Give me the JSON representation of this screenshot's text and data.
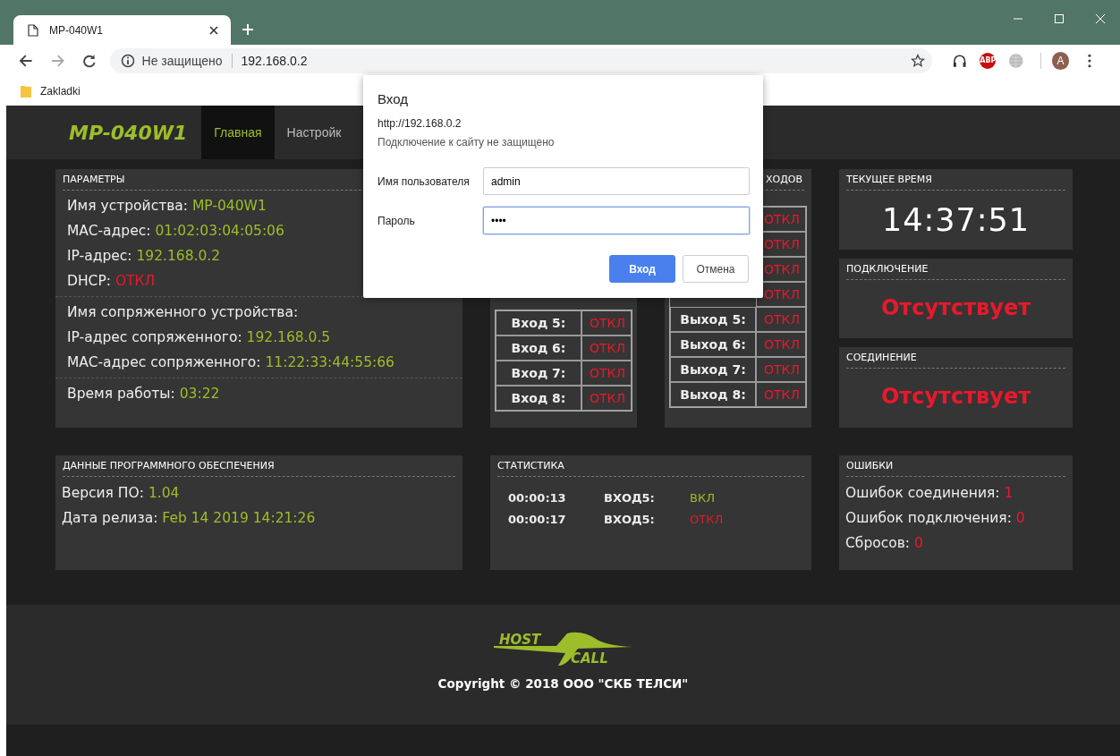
{
  "browser": {
    "tab_title": "MP-040W1",
    "security": "Не защищено",
    "url": "192.168.0.2",
    "bookmarks": [
      "Zakladki"
    ],
    "extension_badge": "ABP",
    "avatar_letter": "A"
  },
  "header": {
    "logo": "MP-040W1",
    "nav": [
      {
        "label": "Главная",
        "selected": true
      },
      {
        "label": "Настройк",
        "selected": false
      }
    ]
  },
  "params": {
    "title": "ПАРАМЕТРЫ",
    "groups": [
      [
        {
          "label": "Имя устройства:",
          "value": "MP-040W1",
          "kind": "info"
        },
        {
          "label": "MAC-адрес:",
          "value": "01:02:03:04:05:06",
          "kind": "info"
        },
        {
          "label": "IP-адрес:",
          "value": "192.168.0.2",
          "kind": "info"
        },
        {
          "label": "DHCP:",
          "value": "ОТКЛ",
          "kind": "off"
        }
      ],
      [
        {
          "label": "Имя сопряженного устройства:"
        },
        {
          "label": "IP-адрес сопряженного:",
          "value": "192.168.0.5",
          "kind": "info"
        },
        {
          "label": "MAC-адрес сопряженного:",
          "value": "11:22:33:44:55:66",
          "kind": "info"
        }
      ],
      [
        {
          "label": "Время работы:",
          "value": "03:22",
          "kind": "info"
        }
      ]
    ]
  },
  "inputs": {
    "rows": [
      {
        "label": "Вход 5:",
        "value": "ОТКЛ",
        "on": false
      },
      {
        "label": "Вход 6:",
        "value": "ОТКЛ",
        "on": false
      },
      {
        "label": "Вход 7:",
        "value": "ОТКЛ",
        "on": false
      },
      {
        "label": "Вход 8:",
        "value": "ОТКЛ",
        "on": false
      }
    ]
  },
  "outputs": {
    "title": "ХОДОВ",
    "rows": [
      {
        "value": "ОТКЛ",
        "on": false
      },
      {
        "value": "ОТКЛ",
        "on": false
      },
      {
        "value": "ОТКЛ",
        "on": false
      },
      {
        "value": "ОТКЛ",
        "on": false
      },
      {
        "label": "Выход 5:",
        "value": "ОТКЛ",
        "on": false
      },
      {
        "label": "Выход 6:",
        "value": "ОТКЛ",
        "on": false
      },
      {
        "label": "Выход 7:",
        "value": "ОТКЛ",
        "on": false
      },
      {
        "label": "Выход 8:",
        "value": "ОТКЛ",
        "on": false
      }
    ]
  },
  "clock": {
    "title": "ТЕКУЩЕЕ ВРЕМЯ",
    "time": "14:37:51"
  },
  "connection": {
    "title": "ПОДКЛЮЧЕНИЕ",
    "status": "Отсутствует",
    "ok": false
  },
  "link": {
    "title": "СОЕДИНЕНИЕ",
    "status": "Отсутствует",
    "ok": false
  },
  "software": {
    "title": "ДАННЫЕ ПРОГРАММНОГО ОБЕСПЕЧЕНИЯ",
    "rows": [
      {
        "label": "Версия ПО:",
        "value": "1.04",
        "kind": "info"
      },
      {
        "label": "Дата релиза:",
        "value": "Feb 14 2019 14:21:26",
        "kind": "info"
      }
    ]
  },
  "stats": {
    "title": "СТАТИСТИКА",
    "rows": [
      {
        "time": "00:00:13",
        "channel": "ВХОД5:",
        "value": "ВКЛ",
        "on": true
      },
      {
        "time": "00:00:17",
        "channel": "ВХОД5:",
        "value": "ОТКЛ",
        "on": false
      }
    ]
  },
  "errors": {
    "title": "ОШИБКИ",
    "rows": [
      {
        "label": "Ошибок соединения:",
        "value": "1",
        "kind": "off"
      },
      {
        "label": "Ошибок подключения:",
        "value": "0",
        "kind": "off"
      },
      {
        "label": "Сбросов:",
        "value": "0",
        "kind": "off"
      }
    ]
  },
  "footer": {
    "logo": [
      "HOST",
      "CALL"
    ],
    "copyright": "Copyright © 2018 ООО \"СКБ ТЕЛСИ\""
  },
  "dialog": {
    "title": "Вход",
    "origin": "http://192.168.0.2",
    "note": "Подключение к сайту не защищено",
    "fields": [
      {
        "label": "Имя пользователя",
        "value": "admin",
        "focused": false
      },
      {
        "label": "Пароль",
        "value": "••••",
        "focused": true
      }
    ],
    "buttons": [
      {
        "label": "Вход",
        "primary": true
      },
      {
        "label": "Отмена",
        "primary": false
      }
    ]
  }
}
